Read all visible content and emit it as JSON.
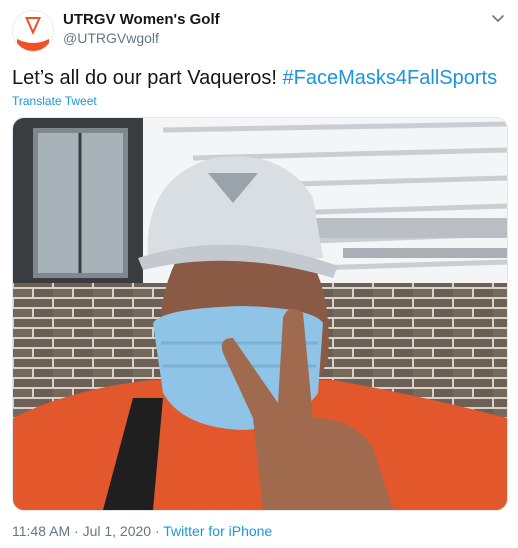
{
  "tweet": {
    "author_name": "UTRGV Women's Golf",
    "author_handle": "@UTRGVwgolf",
    "text_plain": "Let’s all do our part Vaqueros! ",
    "hashtag": "#FaceMasks4FallSports",
    "translate_label": "Translate Tweet",
    "time": "11:48 AM",
    "separator": " · ",
    "date": "Jul 1, 2020",
    "source": "Twitter for iPhone"
  },
  "icons": {
    "more": "chevron-down-icon",
    "avatar": "utrgv-logo"
  },
  "colors": {
    "link": "#1b95e0",
    "secondary_text": "#657786",
    "primary_text": "#14171a",
    "logo_orange": "#f05023"
  }
}
